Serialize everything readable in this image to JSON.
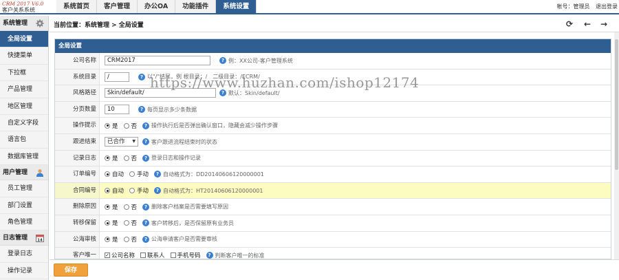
{
  "logo": {
    "line1": "CRM 2017 V6.0",
    "line2": "客户关系系统"
  },
  "topnav": [
    "系统首页",
    "客户管理",
    "办公OA",
    "功能插件",
    "系统设置"
  ],
  "topnav_active": 4,
  "user": {
    "account": "帐号：管理员",
    "logout": "退出登录"
  },
  "sidebar": {
    "section1": "系统管理",
    "items1": [
      "全局设置",
      "快捷菜单",
      "下拉框",
      "产品管理",
      "地区管理",
      "自定义字段",
      "语言包",
      "数据库管理"
    ],
    "section2": "用户管理",
    "items2": [
      "员工管理",
      "部门设置",
      "角色管理"
    ],
    "section3": "日志管理",
    "items3": [
      "登录日志",
      "操作记录"
    ],
    "date_badge": "14"
  },
  "breadcrumb": "当前位置：系统管理 > 全局设置",
  "panel_title": "全局设置",
  "form": {
    "company": {
      "label": "公司名称",
      "value": "CRM2017",
      "hint": "例：XX公司-客户管理系统"
    },
    "sysdir": {
      "label": "系统目录",
      "value": "/",
      "hint": "以\"/\"结尾，例 根目录：/　二级目录：/ECRM/"
    },
    "style": {
      "label": "风格路径",
      "value": "Skin/default/",
      "hint": "默认：Skin/default/"
    },
    "pagesize": {
      "label": "分页数量",
      "value": "10",
      "hint": "每页显示多少条数据"
    },
    "optip": {
      "label": "操作提示",
      "opt1": "是",
      "opt2": "否",
      "hint": "操作执行后是否弹出确认窗口，隐藏会减少操作步骤"
    },
    "followup": {
      "label": "跟进结束",
      "selected": "已合作",
      "hint": "客户跟进流程结束时的状态"
    },
    "logrec": {
      "label": "记录日志",
      "opt1": "是",
      "opt2": "否",
      "hint": "登录日志和操作记录"
    },
    "orderno": {
      "label": "订单编号",
      "opt1": "自动",
      "opt2": "手动",
      "hint": "自动格式为：DD20140606120000001"
    },
    "contractno": {
      "label": "合同编号",
      "opt1": "自动",
      "opt2": "手动",
      "hint": "自动格式为：HT20140606120000001"
    },
    "delreason": {
      "label": "删除原因",
      "opt1": "是",
      "opt2": "否",
      "hint": "删除客户档案是否需要填写原因"
    },
    "transfer": {
      "label": "转移保留",
      "opt1": "是",
      "opt2": "否",
      "hint": "客户转移后，是否保留原有业务员"
    },
    "seapprove": {
      "label": "公海审核",
      "opt1": "是",
      "opt2": "否",
      "hint": "公海申请客户是否需要审核"
    },
    "unique": {
      "label": "客户唯一",
      "c1": "公司名称",
      "c2": "联系人",
      "c3": "手机号码",
      "hint": "判断客户唯一的标准"
    }
  },
  "watermark": "https://www.huzhan.com/ishop12174",
  "save_label": "保存",
  "colors": {
    "primary": "#2f5e93",
    "highlight": "#fcfcc0",
    "save": "#f0a13c"
  }
}
